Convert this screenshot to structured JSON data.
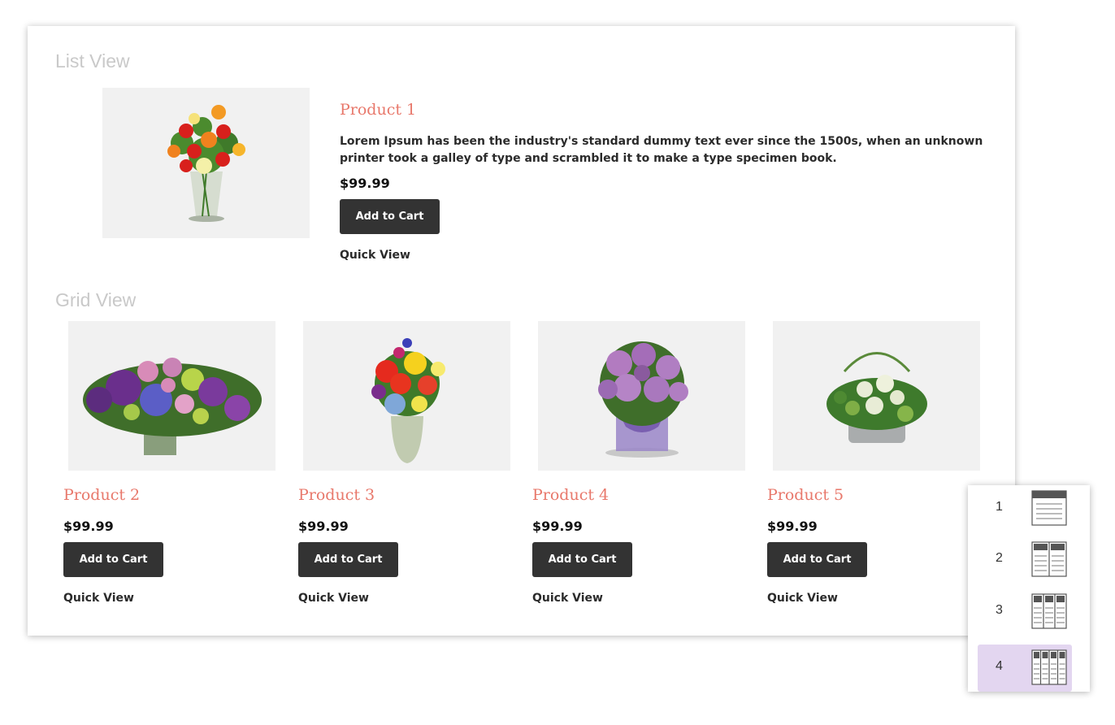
{
  "list_view": {
    "title": "List View",
    "product": {
      "name": "Product 1",
      "description": "Lorem Ipsum has been the industry's standard dummy text ever since the 1500s, when an unknown printer took a galley of type and scrambled it to make a type specimen book.",
      "price": "$99.99",
      "cart_label": "Add to Cart",
      "quick_view_label": "Quick View",
      "image": "flower-bouquet-icon"
    }
  },
  "grid_view": {
    "title": "Grid View",
    "products": [
      {
        "name": "Product 2",
        "price": "$99.99",
        "cart_label": "Add to Cart",
        "quick_view_label": "Quick View",
        "image": "flower-bouquet-icon"
      },
      {
        "name": "Product 3",
        "price": "$99.99",
        "cart_label": "Add to Cart",
        "quick_view_label": "Quick View",
        "image": "flower-bouquet-icon"
      },
      {
        "name": "Product 4",
        "price": "$99.99",
        "cart_label": "Add to Cart",
        "quick_view_label": "Quick View",
        "image": "flower-bouquet-icon"
      },
      {
        "name": "Product 5",
        "price": "$99.99",
        "cart_label": "Add to Cart",
        "quick_view_label": "Quick View",
        "image": "flower-bouquet-icon"
      }
    ]
  },
  "layout_switcher": {
    "options": [
      {
        "label": "1",
        "icon": "one-column-layout-icon"
      },
      {
        "label": "2",
        "icon": "two-column-layout-icon"
      },
      {
        "label": "3",
        "icon": "three-column-layout-icon"
      },
      {
        "label": "4",
        "icon": "four-column-layout-icon"
      }
    ],
    "selected": "4"
  },
  "colors": {
    "product_name": "#e8786b",
    "button_bg": "#333333",
    "selected_option_bg": "#e3d6f0",
    "image_bg": "#f1f1f1"
  }
}
